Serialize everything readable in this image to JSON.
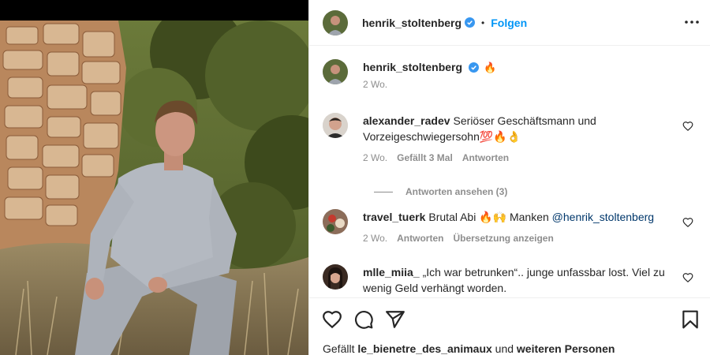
{
  "header": {
    "username": "henrik_stoltenberg",
    "separator": "•",
    "follow_label": "Folgen",
    "more_icon": "more-horizontal-icon"
  },
  "caption": {
    "username": "henrik_stoltenberg",
    "text": "🔥",
    "time": "2 Wo."
  },
  "comments": [
    {
      "username": "alexander_radev",
      "text": "Seriöser Geschäftsmann und Vorzeigeschwiegersohn💯🔥👌",
      "time": "2 Wo.",
      "likes": "Gefällt 3 Mal",
      "reply": "Antworten",
      "view_replies": "Antworten ansehen (3)"
    },
    {
      "username": "travel_tuerk",
      "text": "Brutal Abi 🔥🙌 Manken ",
      "mention": "@henrik_stoltenberg",
      "time": "2 Wo.",
      "reply": "Antworten",
      "translate": "Übersetzung anzeigen"
    },
    {
      "username": "mlle_miia_",
      "text": "„Ich war betrunken“.. junge unfassbar lost. Viel zu wenig Geld verhängt worden."
    }
  ],
  "actions": {
    "like_icon": "heart-icon",
    "comment_icon": "comment-icon",
    "share_icon": "share-icon",
    "save_icon": "bookmark-icon"
  },
  "likes": {
    "prefix": "Gefällt ",
    "user": "le_bienetre_des_animaux",
    "middle": " und ",
    "others": "weiteren Personen"
  },
  "colors": {
    "accent": "#0095f6",
    "text": "#262626",
    "secondary": "#8e8e8e",
    "border": "#efefef",
    "verified": "#3897f0"
  }
}
